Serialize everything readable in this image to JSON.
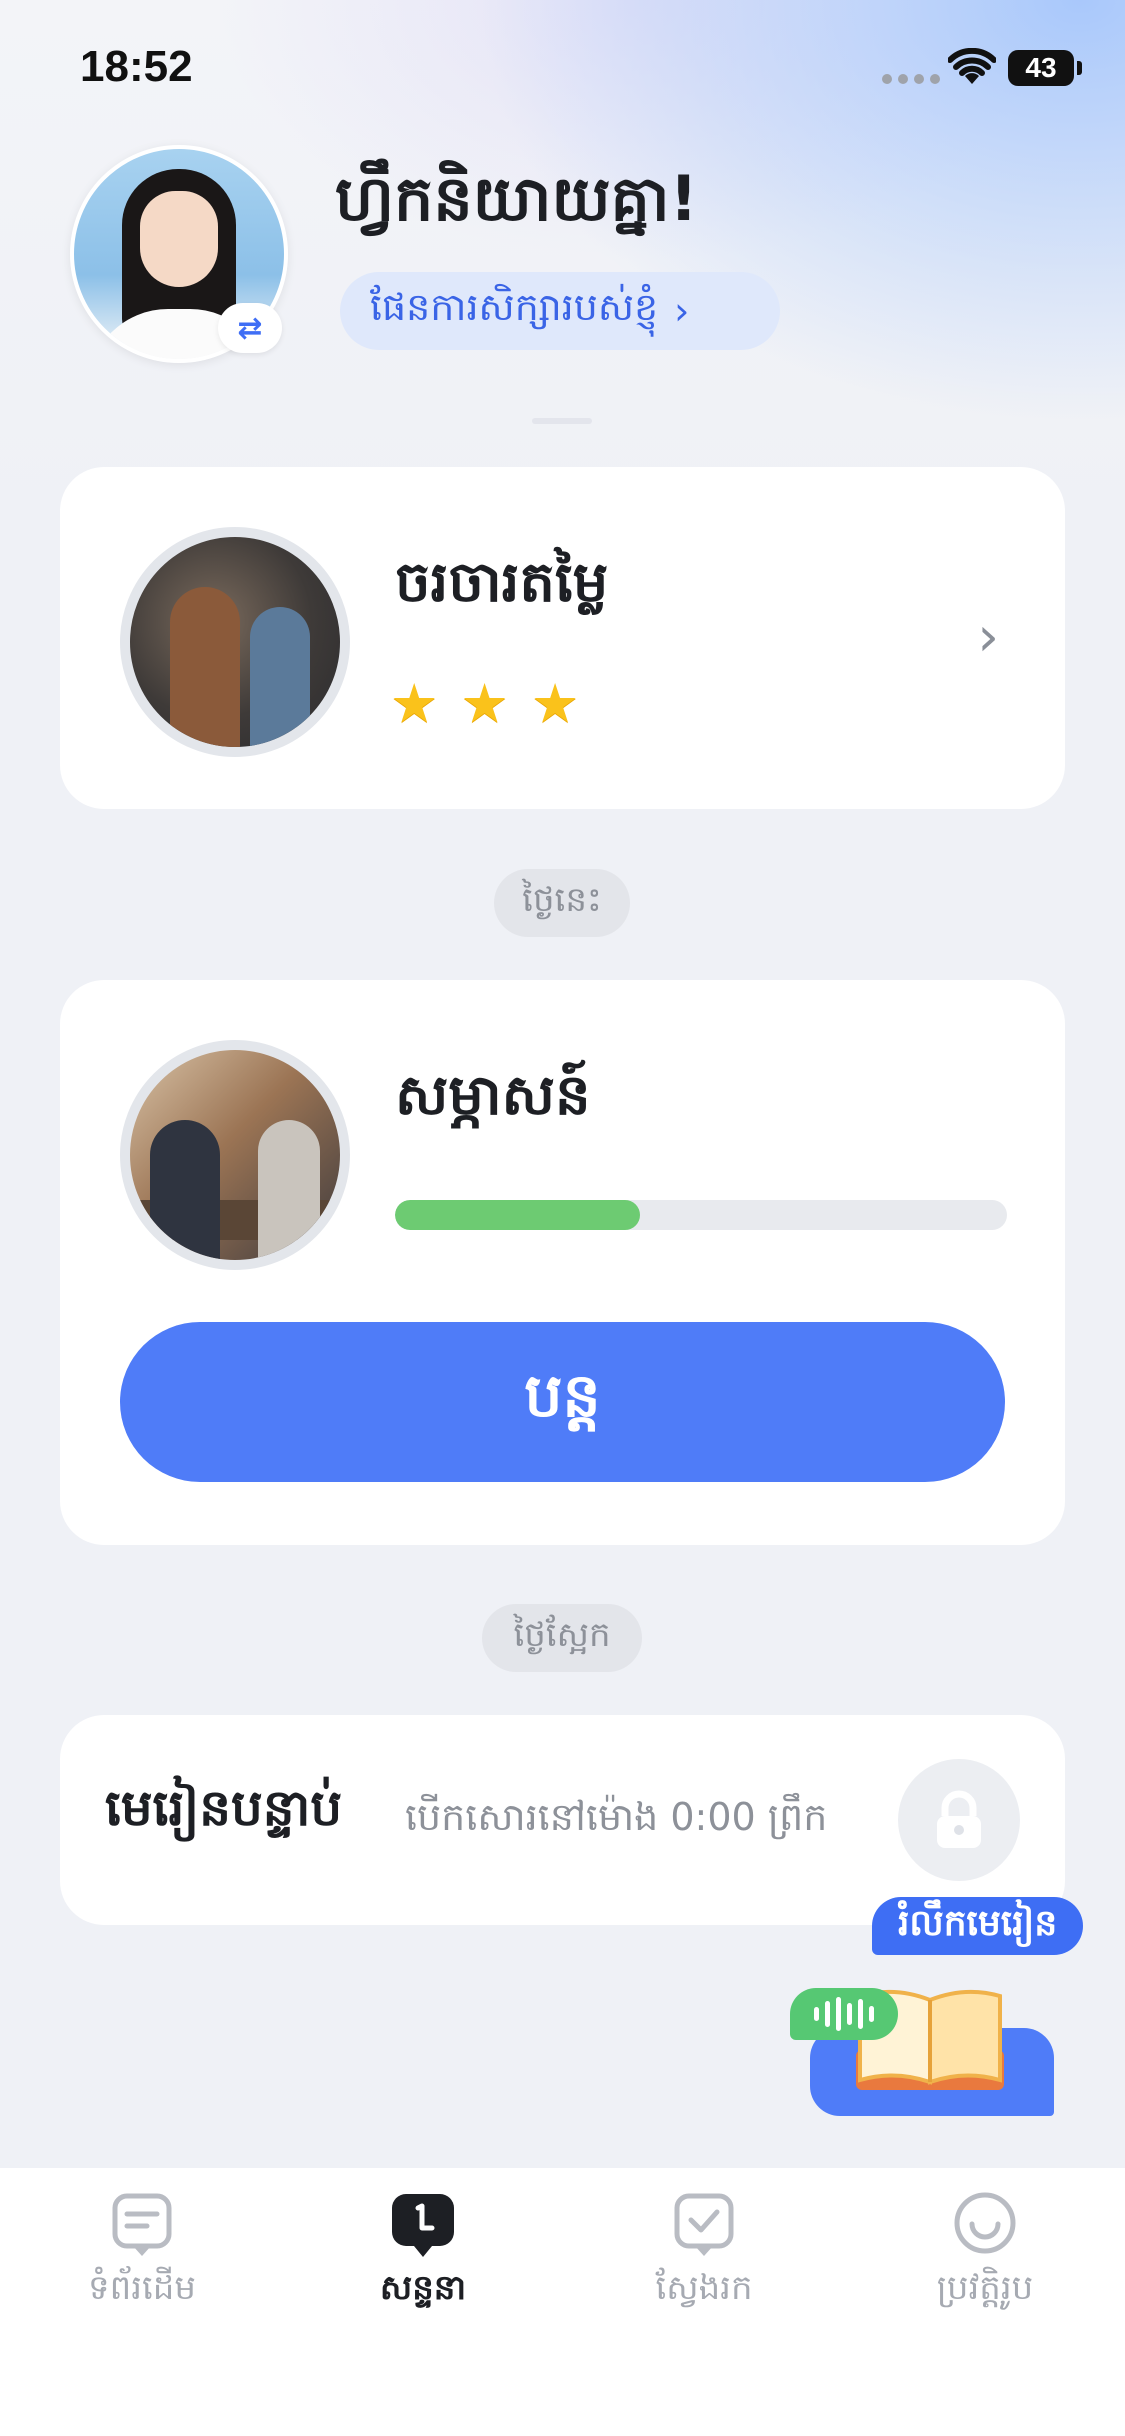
{
  "status_bar": {
    "time": "18:52",
    "battery": "43"
  },
  "header": {
    "greeting": "ហ្វឹកនិយាយគ្នា!",
    "plan_link": "ផែនការសិក្សារបស់ខ្ញុំ",
    "plan_chevron": "›",
    "swap_icon": "⇄"
  },
  "lesson_completed": {
    "title": "ចរចារតម្លៃ",
    "stars": 3,
    "star_glyph": "★",
    "chevron": "›"
  },
  "today": {
    "label": "ថ្ងៃនេះ",
    "lesson_title": "សម្ភាសន៍",
    "progress": 0.4,
    "button_label": "បន្ត"
  },
  "tomorrow": {
    "label": "ថ្ងៃស្អែក",
    "lesson_title": "មេរៀនបន្ទាប់",
    "unlock_note": "បើកសោរនៅម៉ោង 0:00 ព្រឹក"
  },
  "review_widget": {
    "bubble_text": "រំលឹកមេរៀន"
  },
  "tabbar": {
    "tabs": [
      {
        "label": "ទំព័រដើម",
        "icon": "chat-card-icon",
        "active": false
      },
      {
        "label": "សន្ទនា",
        "icon": "conversation-icon",
        "active": true
      },
      {
        "label": "ស្វែងរក",
        "icon": "check-card-icon",
        "active": false
      },
      {
        "label": "ប្រវត្តិរូប",
        "icon": "smile-face-icon",
        "active": false
      }
    ]
  },
  "colors": {
    "accent": "#4f7cf8",
    "progress": "#6dcb72",
    "star": "#fac21b",
    "background": "#eff1f6"
  }
}
